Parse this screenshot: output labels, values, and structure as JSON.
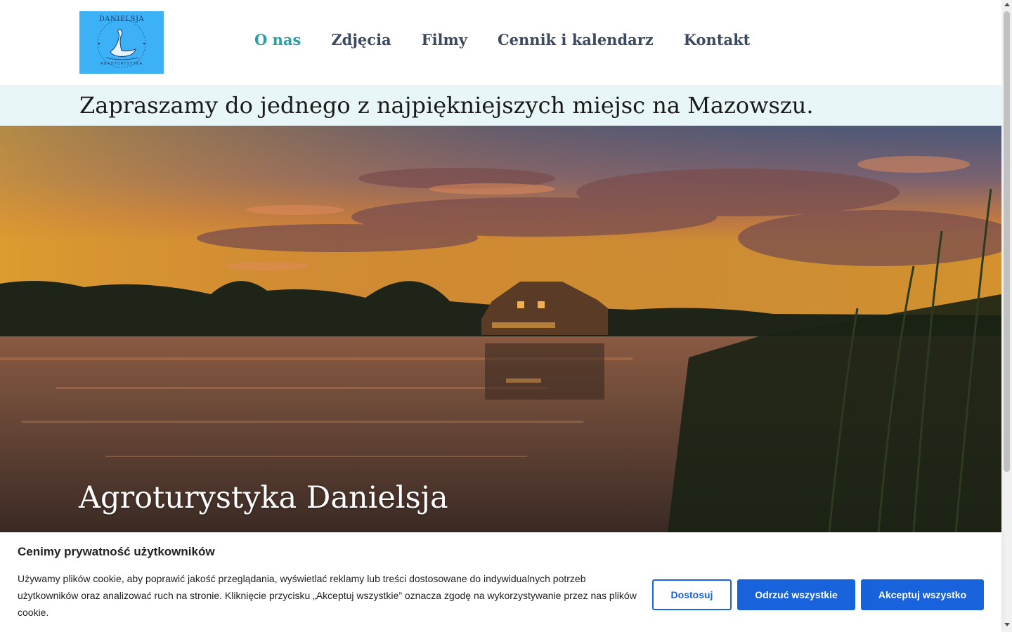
{
  "logo": {
    "text_top": "DANIELSJA",
    "text_bottom": "AGROTURYSTYKA",
    "background": "#3db1f5"
  },
  "nav": {
    "items": [
      {
        "label": "O nas",
        "active": true
      },
      {
        "label": "Zdjęcia",
        "active": false
      },
      {
        "label": "Filmy",
        "active": false
      },
      {
        "label": "Cennik i kalendarz",
        "active": false
      },
      {
        "label": "Kontakt",
        "active": false
      }
    ],
    "active_color": "#2a9fa6",
    "color": "#3b4a5e"
  },
  "tagline": "Zapraszamy do jednego z najpiękniejszych miejsc na Mazowszu.",
  "hero": {
    "title": "Agroturystyka Danielsja",
    "image": "sunset-lake-house-photo"
  },
  "cookie_banner": {
    "title": "Cenimy prywatność użytkowników",
    "text": "Używamy plików cookie, aby poprawić jakość przeglądania, wyświetlać reklamy lub treści dostosowane do indywidualnych potrzeb użytkowników oraz analizować ruch na stronie. Kliknięcie przycisku „Akceptuj wszystkie” oznacza zgodę na wykorzystywanie przez nas plików cookie.",
    "customize_label": "Dostosuj",
    "reject_label": "Odrzuć wszystkie",
    "accept_label": "Akceptuj wszystko",
    "accent": "#1863dc"
  }
}
